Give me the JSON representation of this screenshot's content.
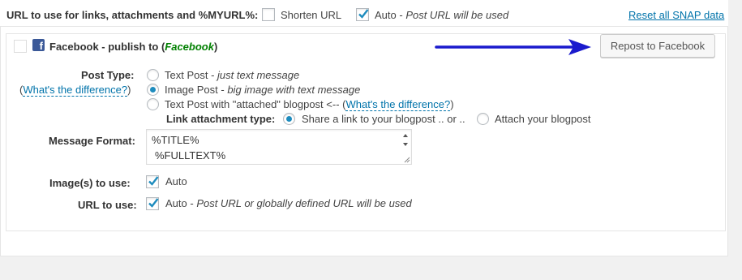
{
  "topbar": {
    "url_label": "URL to use for links, attachments and %MYURL%:",
    "shorten_label": "Shorten URL",
    "shorten_checked": false,
    "auto_label": "Auto",
    "auto_note": "Post URL will be used",
    "auto_checked": true,
    "reset_link": "Reset all SNAP data"
  },
  "facebook": {
    "title_prefix": "Facebook - publish to (",
    "title_name": "Facebook",
    "title_suffix": ")",
    "enabled": false,
    "repost_button": "Repost to Facebook"
  },
  "post_type": {
    "label": "Post Type:",
    "difference_open": "(",
    "difference_link": "What's the difference?",
    "difference_close": ")",
    "options": [
      {
        "label": "Text Post",
        "note": "just text message",
        "selected": false
      },
      {
        "label": "Image Post",
        "note": "big image with text message",
        "selected": true
      },
      {
        "label": "Text Post with \"attached\" blogpost <-- (",
        "link": "What's the difference?",
        "suffix": ")",
        "selected": false
      }
    ]
  },
  "link_attachment": {
    "label": "Link attachment type:",
    "options": [
      {
        "label": "Share a link to your blogpost .. or ..",
        "selected": true
      },
      {
        "label": "Attach your blogpost",
        "selected": false
      }
    ]
  },
  "message_format": {
    "label": "Message Format:",
    "line1": "%TITLE%",
    "line2": "%FULLTEXT%"
  },
  "images": {
    "label": "Image(s) to use:",
    "auto_label": "Auto",
    "checked": true
  },
  "url_to_use": {
    "label": "URL to use:",
    "auto_label": "Auto",
    "note": "Post URL or globally defined URL will be used",
    "checked": true
  },
  "colors": {
    "accent": "#0073aa",
    "facebook_blue": "#3b5998",
    "facebook_name_green": "#008000",
    "arrow_blue": "#1a1acd"
  }
}
